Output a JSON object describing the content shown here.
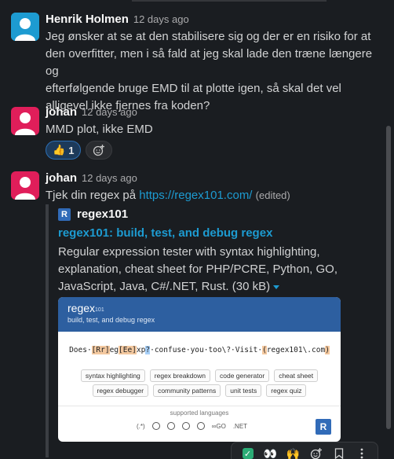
{
  "messages": [
    {
      "author": "Henrik Holmen",
      "time": "12 days ago",
      "lines": [
        "Jeg ønsker at se at den stabilisere sig og der er en risiko for at",
        "den overfitter, men i så fald at jeg skal lade den træne længere og",
        "efterfølgende bruge EMD til at plotte igen, så skal det vel",
        "alligevel ikke fjernes fra koden?"
      ],
      "avatar_color": "#1d9bd1"
    },
    {
      "author": "johan",
      "time": "12 days ago",
      "text": "MMD plot, ikke EMD",
      "avatar_color": "#e01e5a",
      "reaction": {
        "emoji": "👍",
        "count": "1"
      }
    },
    {
      "author": "johan",
      "time": "12 days ago",
      "text_prefix": "Tjek din regex på ",
      "link": "https://regex101.com/",
      "edited": "(edited)",
      "avatar_color": "#e01e5a"
    }
  ],
  "unfurl": {
    "site_icon": "R",
    "site_name": "regex101",
    "title": "regex101: build, test, and debug regex",
    "desc_lines": [
      "Regular expression tester with syntax highlighting,",
      "explanation, cheat sheet for PHP/PCRE, Python, GO,",
      "JavaScript, Java, C#/.NET, Rust. (30 kB)"
    ],
    "preview": {
      "logo": "regex",
      "logo_sub": "101",
      "tagline": "build, test, and debug regex",
      "regex_parts": {
        "p1": "Does·",
        "p2": "[Rr]",
        "p3": "eg",
        "p4": "[Ee]",
        "p5": "xp",
        "p6": "?",
        "p7": "·confuse·you·too\\?·Visit·",
        "p8": "(",
        "p9": "regex101\\.com",
        "p10": ")"
      },
      "chips_row1": [
        "syntax highlighting",
        "regex breakdown",
        "code generator",
        "cheat sheet"
      ],
      "chips_row2": [
        "regex debugger",
        "community patterns",
        "unit tests",
        "regex quiz"
      ],
      "supported": "supported languages",
      "lang_text": "(.*)",
      "lang_go": "∞GO",
      "lang_net": ".NET",
      "badge": "R"
    }
  },
  "toolbar": {
    "check": "✓",
    "eyes": "👀",
    "raised_hands": "🙌"
  }
}
